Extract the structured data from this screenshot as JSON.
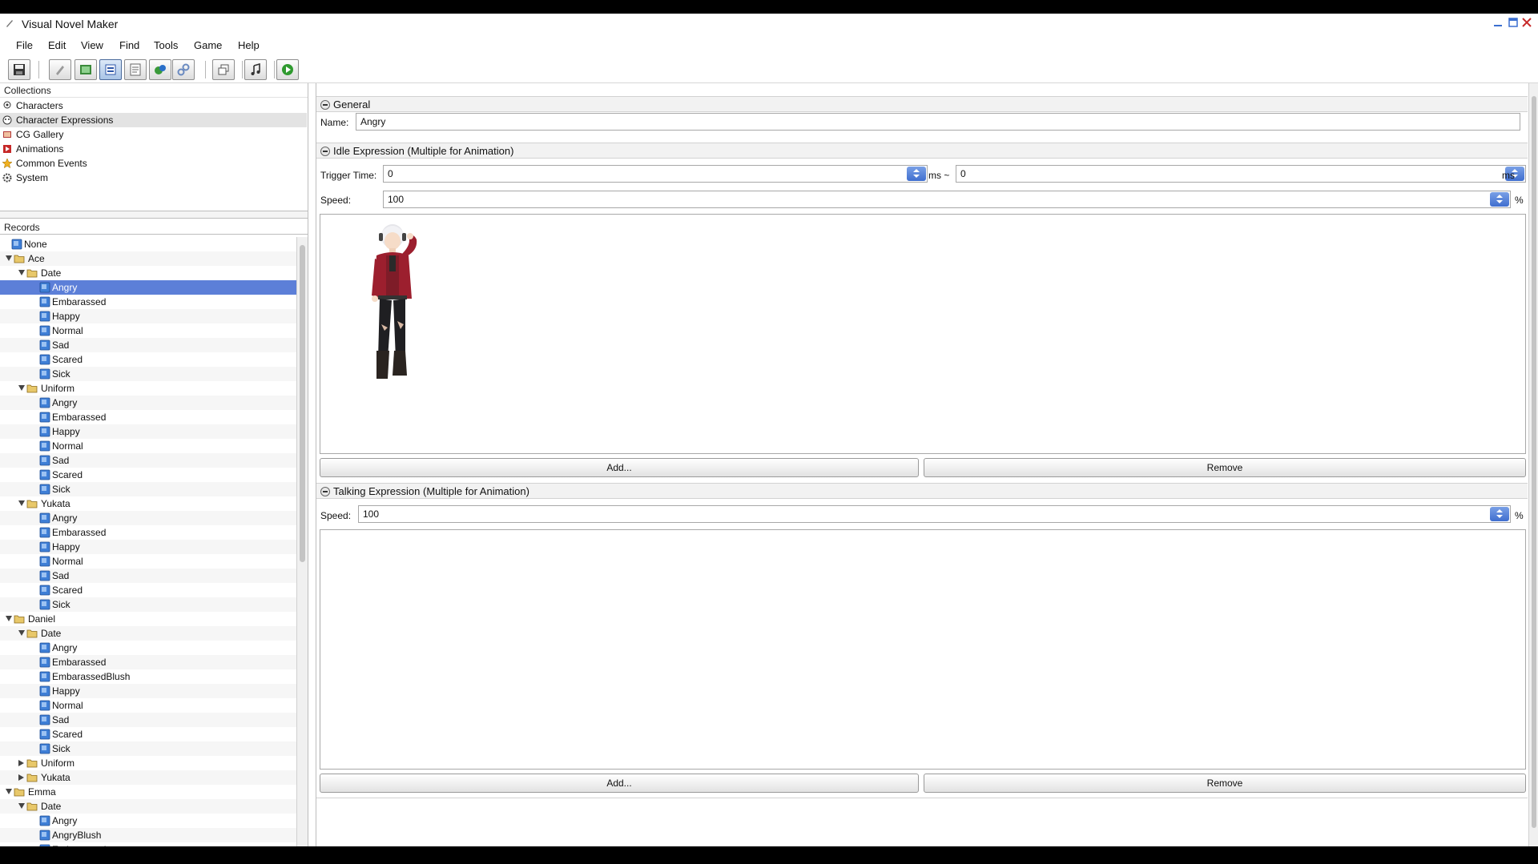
{
  "window": {
    "title": "Visual Novel Maker"
  },
  "menu": [
    "File",
    "Edit",
    "View",
    "Find",
    "Tools",
    "Game",
    "Help"
  ],
  "collections": {
    "header": "Collections",
    "items": [
      {
        "label": "Characters",
        "icon": "characters-icon"
      },
      {
        "label": "Character Expressions",
        "icon": "expressions-icon"
      },
      {
        "label": "CG Gallery",
        "icon": "gallery-icon"
      },
      {
        "label": "Animations",
        "icon": "animations-icon"
      },
      {
        "label": "Common Events",
        "icon": "events-icon"
      },
      {
        "label": "System",
        "icon": "gear-icon"
      }
    ],
    "selected": "Character Expressions"
  },
  "records": {
    "header": "Records",
    "rows": [
      {
        "label": "None",
        "level": 0,
        "type": "record"
      },
      {
        "label": "Ace",
        "level": 0,
        "type": "folder",
        "expanded": true
      },
      {
        "label": "Date",
        "level": 1,
        "type": "folder",
        "expanded": true
      },
      {
        "label": "Angry",
        "level": 2,
        "type": "record",
        "selected": true
      },
      {
        "label": "Embarassed",
        "level": 2,
        "type": "record"
      },
      {
        "label": "Happy",
        "level": 2,
        "type": "record"
      },
      {
        "label": "Normal",
        "level": 2,
        "type": "record"
      },
      {
        "label": "Sad",
        "level": 2,
        "type": "record"
      },
      {
        "label": "Scared",
        "level": 2,
        "type": "record"
      },
      {
        "label": "Sick",
        "level": 2,
        "type": "record"
      },
      {
        "label": "Uniform",
        "level": 1,
        "type": "folder",
        "expanded": true
      },
      {
        "label": "Angry",
        "level": 2,
        "type": "record"
      },
      {
        "label": "Embarassed",
        "level": 2,
        "type": "record"
      },
      {
        "label": "Happy",
        "level": 2,
        "type": "record"
      },
      {
        "label": "Normal",
        "level": 2,
        "type": "record"
      },
      {
        "label": "Sad",
        "level": 2,
        "type": "record"
      },
      {
        "label": "Scared",
        "level": 2,
        "type": "record"
      },
      {
        "label": "Sick",
        "level": 2,
        "type": "record"
      },
      {
        "label": "Yukata",
        "level": 1,
        "type": "folder",
        "expanded": true
      },
      {
        "label": "Angry",
        "level": 2,
        "type": "record"
      },
      {
        "label": "Embarassed",
        "level": 2,
        "type": "record"
      },
      {
        "label": "Happy",
        "level": 2,
        "type": "record"
      },
      {
        "label": "Normal",
        "level": 2,
        "type": "record"
      },
      {
        "label": "Sad",
        "level": 2,
        "type": "record"
      },
      {
        "label": "Scared",
        "level": 2,
        "type": "record"
      },
      {
        "label": "Sick",
        "level": 2,
        "type": "record"
      },
      {
        "label": "Daniel",
        "level": 0,
        "type": "folder",
        "expanded": true
      },
      {
        "label": "Date",
        "level": 1,
        "type": "folder",
        "expanded": true
      },
      {
        "label": "Angry",
        "level": 2,
        "type": "record"
      },
      {
        "label": "Embarassed",
        "level": 2,
        "type": "record"
      },
      {
        "label": "EmbarassedBlush",
        "level": 2,
        "type": "record"
      },
      {
        "label": "Happy",
        "level": 2,
        "type": "record"
      },
      {
        "label": "Normal",
        "level": 2,
        "type": "record"
      },
      {
        "label": "Sad",
        "level": 2,
        "type": "record"
      },
      {
        "label": "Scared",
        "level": 2,
        "type": "record"
      },
      {
        "label": "Sick",
        "level": 2,
        "type": "record"
      },
      {
        "label": "Uniform",
        "level": 1,
        "type": "folder",
        "expanded": false
      },
      {
        "label": "Yukata",
        "level": 1,
        "type": "folder",
        "expanded": false
      },
      {
        "label": "Emma",
        "level": 0,
        "type": "folder",
        "expanded": true
      },
      {
        "label": "Date",
        "level": 1,
        "type": "folder",
        "expanded": true
      },
      {
        "label": "Angry",
        "level": 2,
        "type": "record"
      },
      {
        "label": "AngryBlush",
        "level": 2,
        "type": "record"
      },
      {
        "label": "Embarassed",
        "level": 2,
        "type": "record"
      }
    ]
  },
  "general": {
    "title": "General",
    "name_label": "Name:",
    "name_value": "Angry"
  },
  "idle": {
    "title": "Idle Expression (Multiple for Animation)",
    "trigger_label": "Trigger Time:",
    "trigger_from": "0",
    "trigger_sep": "ms ~",
    "trigger_to": "0",
    "trigger_unit": "ms",
    "speed_label": "Speed:",
    "speed_value": "100",
    "speed_unit": "%",
    "add_label": "Add...",
    "remove_label": "Remove"
  },
  "talking": {
    "title": "Talking Expression (Multiple for Animation)",
    "speed_label": "Speed:",
    "speed_value": "100",
    "speed_unit": "%",
    "add_label": "Add...",
    "remove_label": "Remove"
  },
  "colors": {
    "selection": "#5c7fd8",
    "spinner": "#3f6ecf",
    "folder": "#e8c86a",
    "record_icon": "#3f7fd6"
  }
}
